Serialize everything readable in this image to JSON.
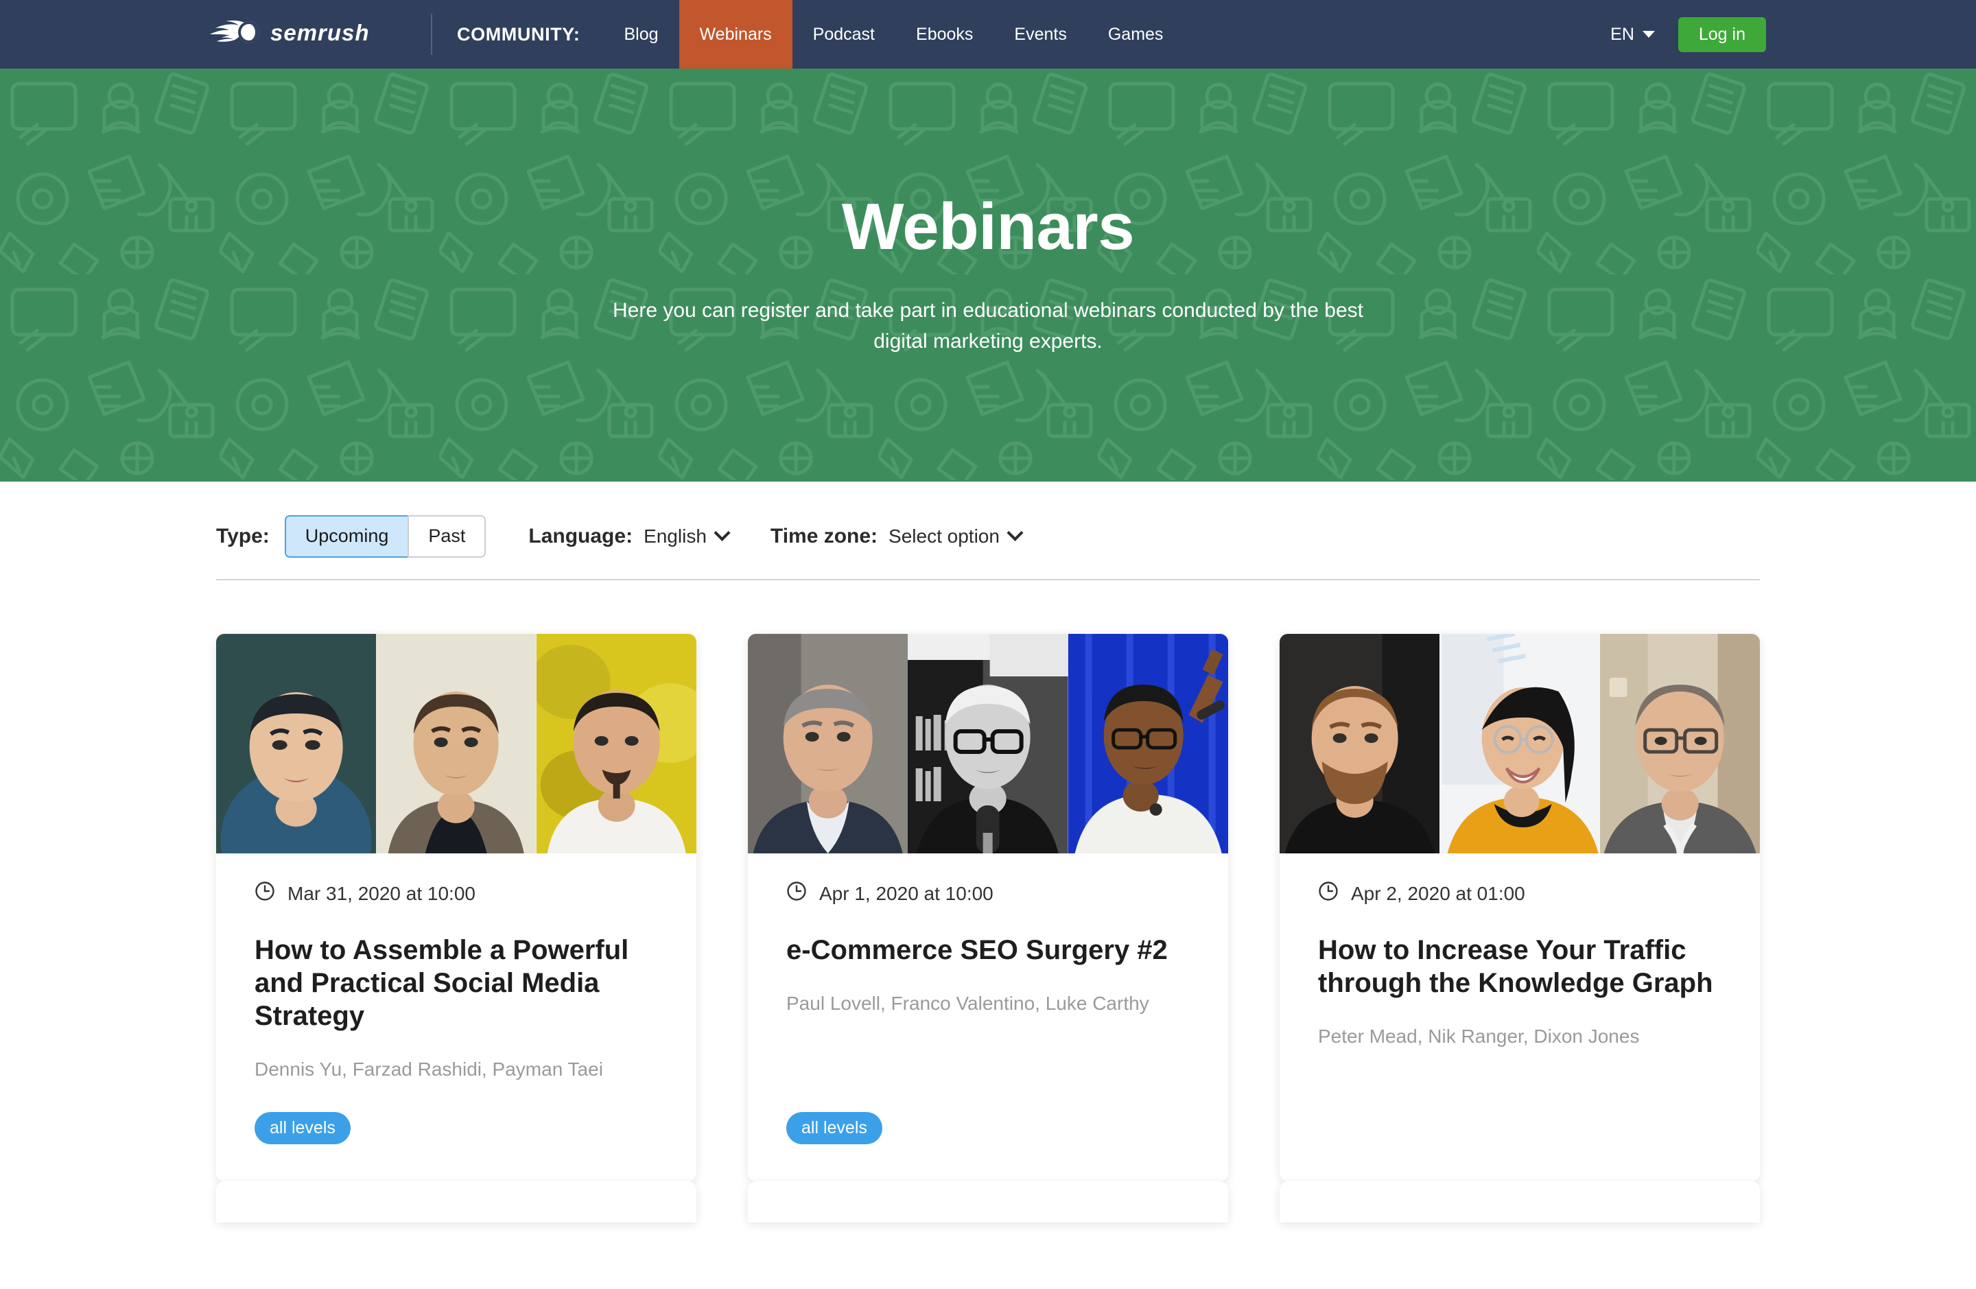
{
  "navbar": {
    "logo_text": "semrush",
    "community_label": "COMMUNITY:",
    "items": [
      {
        "label": "Blog",
        "active": false
      },
      {
        "label": "Webinars",
        "active": true
      },
      {
        "label": "Podcast",
        "active": false
      },
      {
        "label": "Ebooks",
        "active": false
      },
      {
        "label": "Events",
        "active": false
      },
      {
        "label": "Games",
        "active": false
      }
    ],
    "language_code": "EN",
    "login_label": "Log in",
    "colors": {
      "background": "#2f3f5c",
      "active_tab": "#c2562c",
      "login_button": "#3ea939"
    }
  },
  "hero": {
    "title": "Webinars",
    "subtitle": "Here you can register and take part in educational webinars conducted by the best digital marketing experts.",
    "background_color": "#3d8c5c",
    "pattern_color": "#4e9a6b"
  },
  "filters": {
    "type_label": "Type:",
    "type_options": [
      {
        "label": "Upcoming",
        "selected": true
      },
      {
        "label": "Past",
        "selected": false
      }
    ],
    "language_label": "Language:",
    "language_value": "English",
    "timezone_label": "Time zone:",
    "timezone_value": "Select option"
  },
  "cards": [
    {
      "date": "Mar 31, 2020 at 10:00",
      "title": "How to Assemble a Powerful and Practical Social Media Strategy",
      "authors": "Dennis Yu, Farzad Rashidi, Payman Taei",
      "badge": "all levels",
      "badge_color": "#3ba0e8",
      "photos": [
        "speaker-photo-dennis-yu",
        "speaker-photo-farzad-rashidi",
        "speaker-photo-payman-taei"
      ]
    },
    {
      "date": "Apr 1, 2020 at 10:00",
      "title": "e-Commerce SEO Surgery #2",
      "authors": "Paul Lovell, Franco Valentino, Luke Carthy",
      "badge": "all levels",
      "badge_color": "#3ba0e8",
      "photos": [
        "speaker-photo-paul-lovell",
        "speaker-photo-franco-valentino",
        "speaker-photo-luke-carthy"
      ]
    },
    {
      "date": "Apr 2, 2020 at 01:00",
      "title": "How to Increase Your Traffic through the Knowledge Graph",
      "authors": "Peter Mead, Nik Ranger, Dixon Jones",
      "badge": "",
      "badge_color": "#3ba0e8",
      "photos": [
        "speaker-photo-peter-mead",
        "speaker-photo-nik-ranger",
        "speaker-photo-dixon-jones"
      ]
    }
  ]
}
